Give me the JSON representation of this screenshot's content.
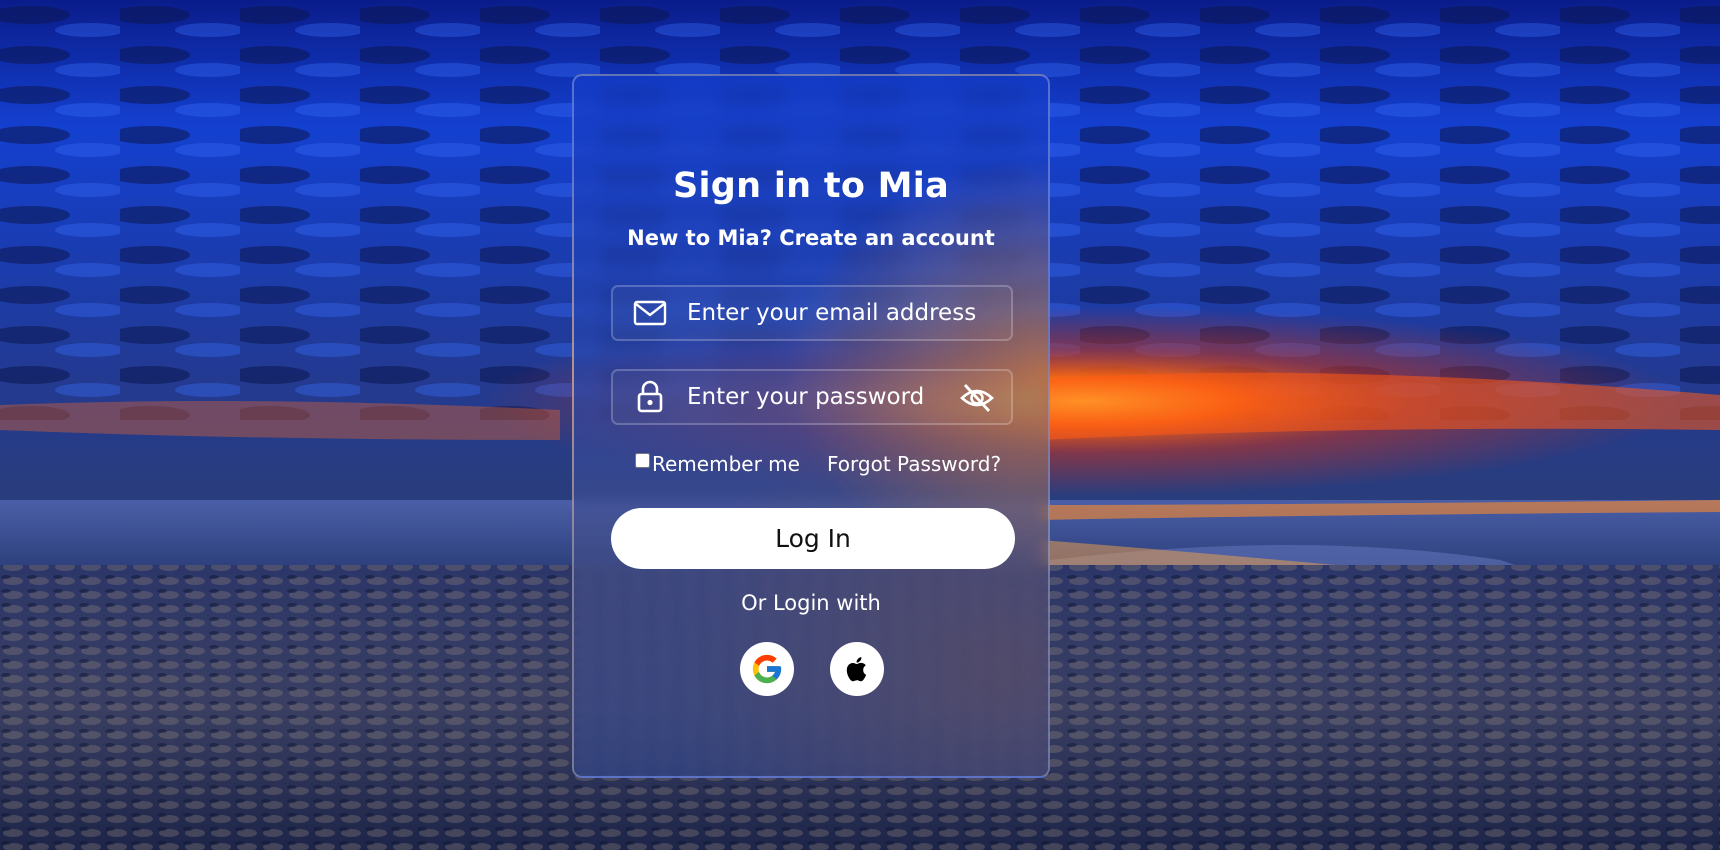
{
  "login": {
    "title": "Sign in to Mia",
    "subtitle": "New to Mia? Create an account",
    "email": {
      "placeholder": "Enter your email address",
      "icon": "mail-icon"
    },
    "password": {
      "placeholder": "Enter your password",
      "icon": "lock-icon",
      "toggle_icon": "eye-off-icon"
    },
    "remember_label": "Remember me",
    "remember_checked": false,
    "forgot_label": "Forgot Password?",
    "login_label": "Log In",
    "or_label": "Or Login with",
    "social": [
      {
        "name": "Google",
        "icon": "google-icon"
      },
      {
        "name": "Apple",
        "icon": "apple-icon"
      }
    ]
  },
  "colors": {
    "text": "#ffffff",
    "button_bg": "#ffffff",
    "button_text": "#111111",
    "card_tint": "#2a46b4",
    "sunset_accent": "#f08c28"
  }
}
